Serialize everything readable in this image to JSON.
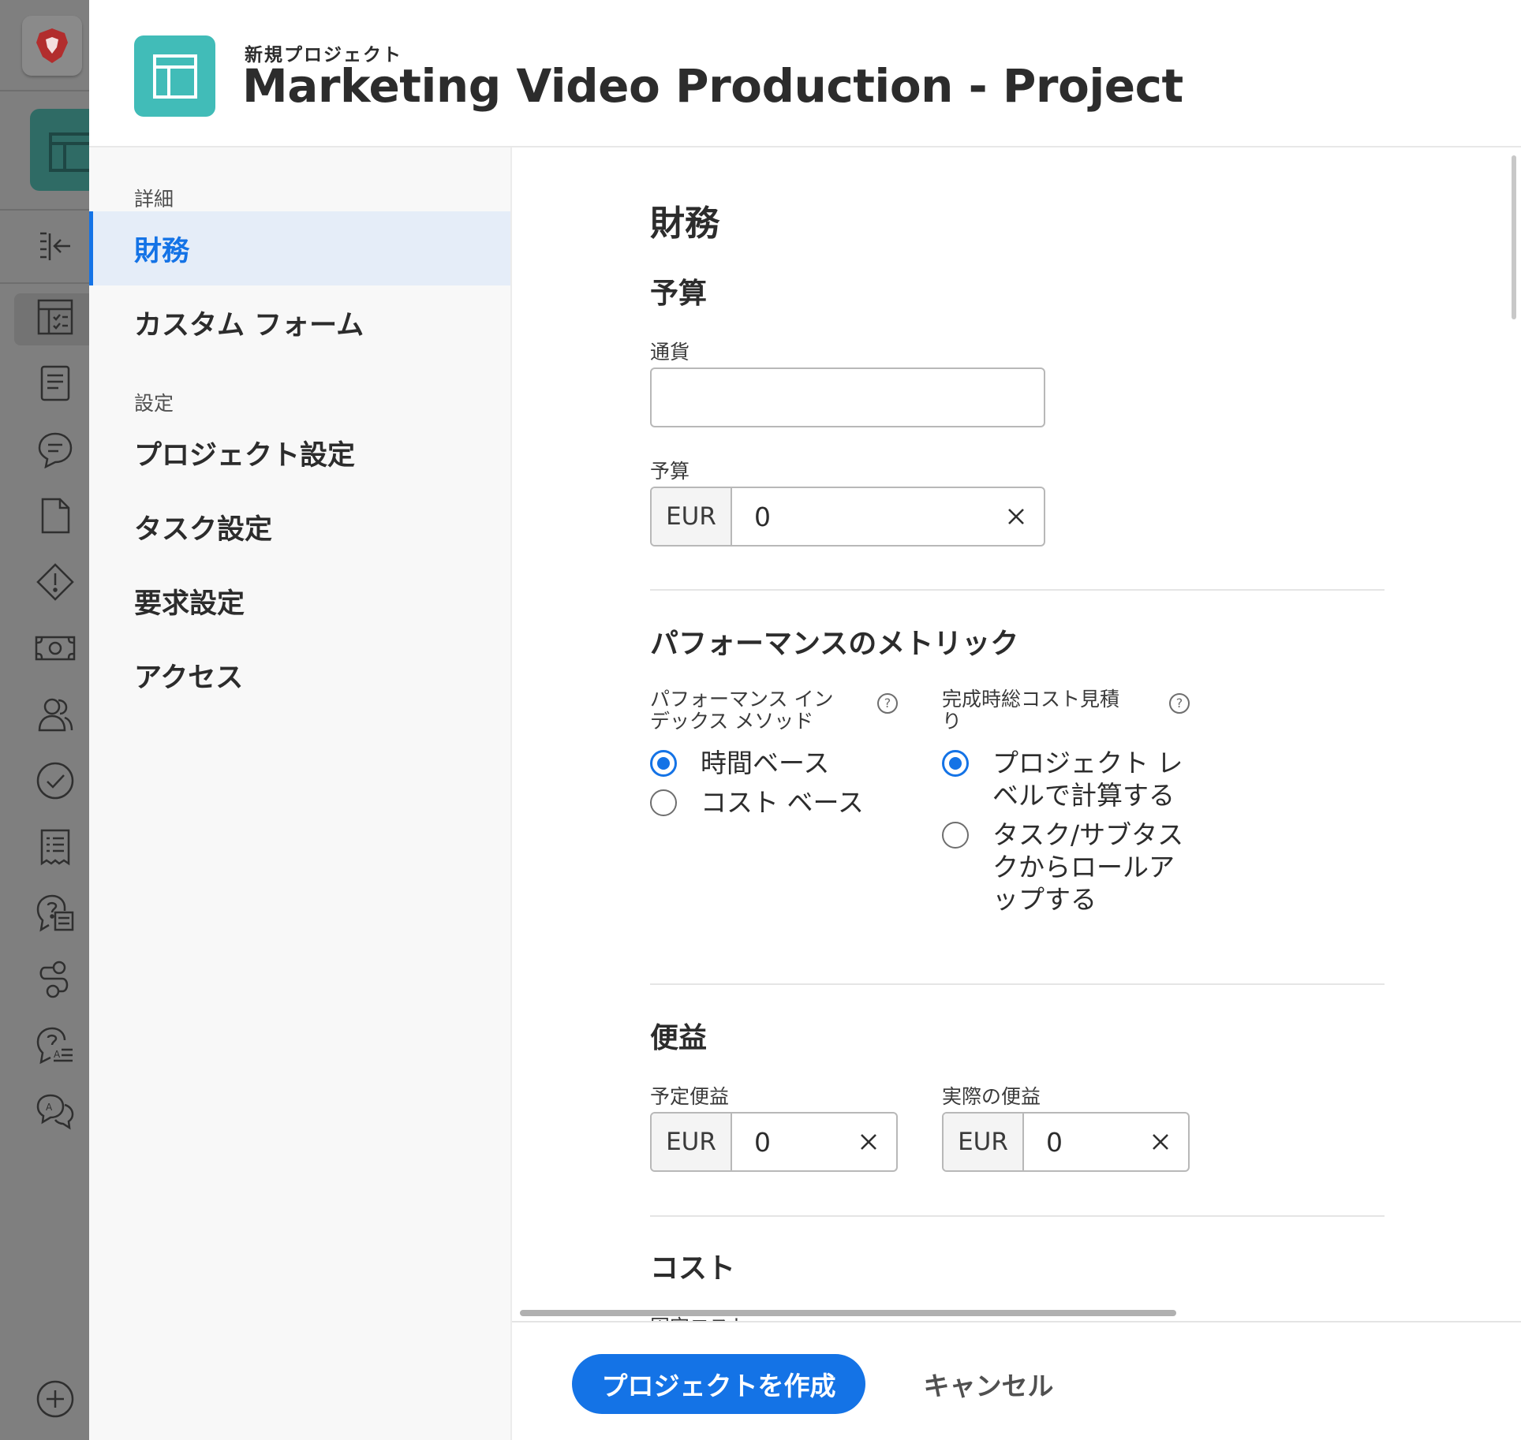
{
  "header": {
    "subtitle": "新規プロジェクト",
    "title": "Marketing Video Production - Project"
  },
  "nav": {
    "section_details": "詳細",
    "section_settings": "設定",
    "items": [
      {
        "label": "財務"
      },
      {
        "label": "カスタム フォーム"
      },
      {
        "label": "プロジェクト設定"
      },
      {
        "label": "タスク設定"
      },
      {
        "label": "要求設定"
      },
      {
        "label": "アクセス"
      }
    ]
  },
  "form": {
    "page_title": "財務",
    "budget_section": "予算",
    "currency_label": "通貨",
    "currency_value": "",
    "budget_label": "予算",
    "budget_currency": "EUR",
    "budget_value": "0",
    "performance_section": "パフォーマンスのメトリック",
    "pim_label_line1": "パフォーマンス イン",
    "pim_label_line2": "デックス メソッド",
    "pim_options": [
      "時間ベース",
      "コスト ベース"
    ],
    "pim_selected": "時間ベース",
    "eac_label_line1": "完成時総コスト見積",
    "eac_label_line2": "り",
    "eac_option1_line1": "プロジェクト レ",
    "eac_option1_line2": "ベルで計算する",
    "eac_option2_line1": "タスク/サブタス",
    "eac_option2_line2": "クからロールア",
    "eac_option2_line3": "ップする",
    "eac_selected": "プロジェクト レベルで計算する",
    "benefit_section": "便益",
    "planned_benefit_label": "予定便益",
    "planned_benefit_currency": "EUR",
    "planned_benefit_value": "0",
    "actual_benefit_label": "実際の便益",
    "actual_benefit_currency": "EUR",
    "actual_benefit_value": "0",
    "cost_section": "コスト",
    "fixed_cost_label": "固定コスト"
  },
  "footer": {
    "create_label": "プロジェクトを作成",
    "cancel_label": "キャンセル"
  },
  "colors": {
    "accent": "#1473e6",
    "app_icon": "#41bcb8",
    "rail_overlay": "#7f7f7f"
  }
}
